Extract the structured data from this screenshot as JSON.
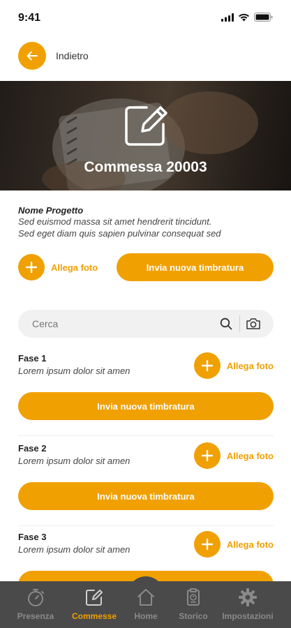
{
  "status": {
    "time": "9:41"
  },
  "header": {
    "back_label": "Indietro"
  },
  "hero": {
    "title": "Commessa 20003"
  },
  "project": {
    "name": "Nome Progetto",
    "description_line1": "Sed euismod massa sit amet hendrerit tincidunt.",
    "description_line2": "Sed eget diam quis sapien pulvinar consequat sed",
    "attach_label": "Allega foto",
    "send_label": "Invia nuova timbratura"
  },
  "search": {
    "placeholder": "Cerca"
  },
  "phases": [
    {
      "title": "Fase 1",
      "description": "Lorem ipsum dolor sit amen",
      "attach_label": "Allega foto",
      "send_label": "Invia nuova timbratura"
    },
    {
      "title": "Fase 2",
      "description": "Lorem ipsum dolor sit amen",
      "attach_label": "Allega foto",
      "send_label": "Invia nuova timbratura"
    },
    {
      "title": "Fase 3",
      "description": "Lorem ipsum dolor sit amen",
      "attach_label": "Allega foto",
      "send_label": ""
    }
  ],
  "tabbar": {
    "active": "Commesse",
    "items": [
      {
        "label": "Presenza",
        "icon": "stopwatch-icon"
      },
      {
        "label": "Commesse",
        "icon": "edit-icon"
      },
      {
        "label": "Home",
        "icon": "home-icon"
      },
      {
        "label": "Storico",
        "icon": "history-document-icon"
      },
      {
        "label": "Impostazioni",
        "icon": "gear-icon"
      }
    ]
  },
  "colors": {
    "accent": "#f0a000",
    "tabbar_bg": "#4a4a4a",
    "inactive_tab": "#8a8a8a"
  }
}
